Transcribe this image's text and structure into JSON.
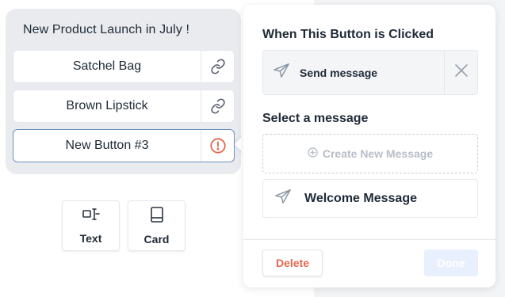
{
  "message": {
    "title": "New Product Launch in July !",
    "buttons": [
      {
        "label": "Satchel Bag",
        "icon": "link-icon"
      },
      {
        "label": "Brown Lipstick",
        "icon": "link-icon"
      },
      {
        "label": "New Button #3",
        "icon": "alert-circle-icon"
      }
    ]
  },
  "add_blocks": [
    {
      "label": "Text",
      "icon": "text-cursor-icon"
    },
    {
      "label": "Card",
      "icon": "card-icon"
    }
  ],
  "panel": {
    "click_title": "When This Button is Clicked",
    "action_label": "Send message",
    "select_title": "Select a message",
    "create_label": "Create New Message",
    "selected_message": "Welcome Message",
    "delete_label": "Delete",
    "done_label": "Done"
  },
  "colors": {
    "accent_blue": "#6f8fbf",
    "danger": "#e5674f",
    "done_bg": "#e8f0fd"
  }
}
